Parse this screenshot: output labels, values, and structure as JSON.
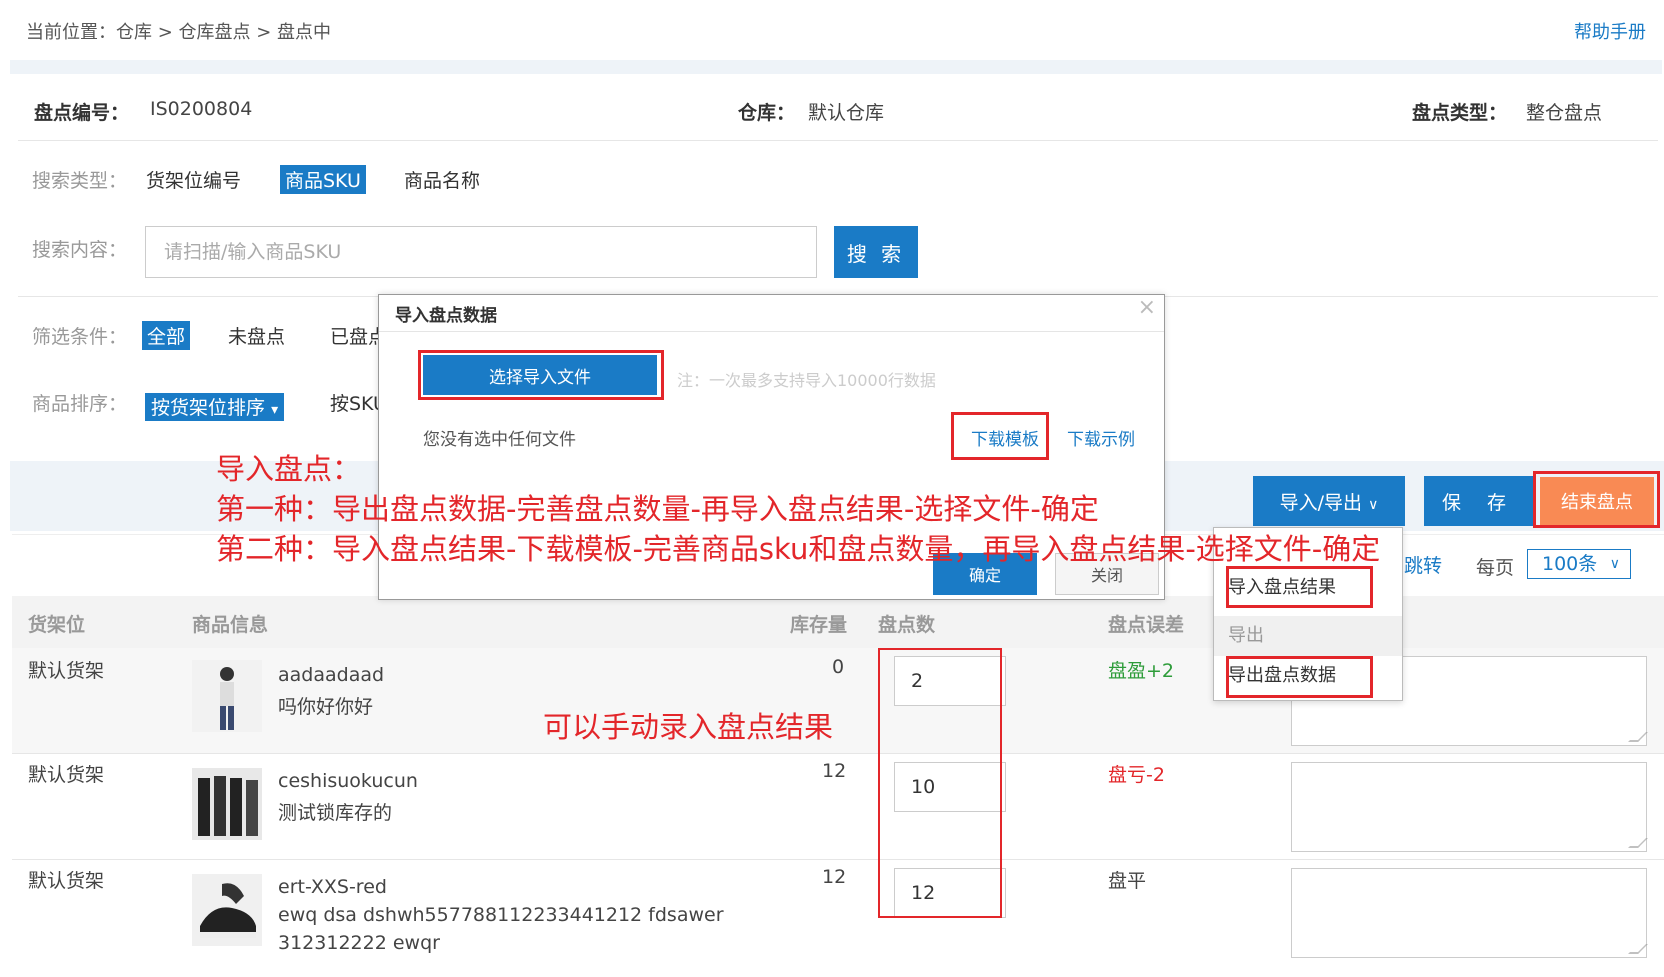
{
  "breadcrumb": "当前位置：仓库 > 仓库盘点 > 盘点中",
  "help_link": "帮助手册",
  "info": {
    "no_label": "盘点编号：",
    "no_value": "IS0200804",
    "warehouse_label": "仓库：",
    "warehouse_value": "默认仓库",
    "type_label": "盘点类型：",
    "type_value": "整仓盘点"
  },
  "search": {
    "type_label": "搜索类型：",
    "types": [
      "货架位编号",
      "商品SKU",
      "商品名称"
    ],
    "content_label": "搜索内容：",
    "placeholder": "请扫描/输入商品SKU",
    "button": "搜 索"
  },
  "filter": {
    "label": "筛选条件：",
    "options": [
      "全部",
      "未盘点",
      "已盘点"
    ]
  },
  "sort": {
    "label": "商品排序：",
    "selected": "按货架位排序",
    "other": "按SKU"
  },
  "toolbar": {
    "import_export": "导入/导出",
    "save": "保 存",
    "finish": "结束盘点"
  },
  "pager": {
    "jump": "跳转",
    "per_page": "每页",
    "size": "100条"
  },
  "table": {
    "headers": [
      "货架位",
      "商品信息",
      "库存量",
      "盘点数",
      "盘点误差"
    ],
    "rows": [
      {
        "shelf": "默认货架",
        "sku": "aadaadaad",
        "name": "吗你好你好",
        "name2": "",
        "stock": "0",
        "count": "2",
        "diff": "盘盈+2",
        "diff_color": "#2e9c3a"
      },
      {
        "shelf": "默认货架",
        "sku": "ceshisuokucun",
        "name": "测试锁库存的",
        "name2": "",
        "stock": "12",
        "count": "10",
        "diff": "盘亏-2",
        "diff_color": "#e3262a"
      },
      {
        "shelf": "默认货架",
        "sku": "ert-XXS-red",
        "name": "ewq dsa dshwh557788112233441212 fdsawer",
        "name2": "312312222 ewqr",
        "stock": "12",
        "count": "12",
        "diff": "盘平",
        "diff_color": "#444444"
      }
    ]
  },
  "dialog": {
    "title": "导入盘点数据",
    "close": "×",
    "choose_file": "选择导入文件",
    "note": "注：一次最多支持导入10000行数据",
    "no_file": "您没有选中任何文件",
    "download_template": "下载模板",
    "download_example": "下载示例",
    "ok": "确定",
    "cancel": "关闭"
  },
  "dropdown": {
    "import_result": "导入盘点结果",
    "export_group": "导出",
    "export_data": "导出盘点数据"
  },
  "annotations": {
    "title": "导入盘点：",
    "line1": "第一种：导出盘点数据-完善盘点数量-再导入盘点结果-选择文件-确定",
    "line2": "第二种：导入盘点结果-下载模板-完善商品sku和盘点数量，再导入盘点结果-选择文件-确定",
    "manual": "可以手动录入盘点结果"
  },
  "colors": {
    "primary": "#1a7bc6",
    "danger_button": "#f98a54",
    "annotation": "#e3262a"
  }
}
